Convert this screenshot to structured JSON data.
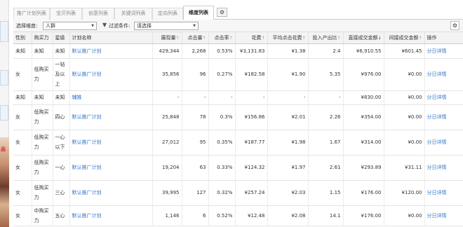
{
  "tabs": [
    {
      "label": "推广计划列表",
      "active": false
    },
    {
      "label": "宝贝列表",
      "active": false
    },
    {
      "label": "创意列表",
      "active": false
    },
    {
      "label": "关键词列表",
      "active": false
    },
    {
      "label": "定向列表",
      "active": false
    },
    {
      "label": "维度列表",
      "active": true
    }
  ],
  "tab_settings_icon": "gear-icon",
  "filter": {
    "dimension_label": "选择维度:",
    "dimension_value": "人群",
    "condition_label": "过滤条件:",
    "condition_value": "请选择",
    "settings_icon": "gear-icon"
  },
  "left_strip": {
    "banner_char": "品"
  },
  "columns": {
    "gender": "性别",
    "spending": "购买力",
    "star": "星级",
    "plan": "计划名称",
    "impressions": "展现量",
    "clicks": "点击量",
    "ctr": "点击率",
    "cost": "花费",
    "cpc": "平均点击花费",
    "roi": "投入产出比",
    "direct": "直接成交金额",
    "indirect": "间接成交金额",
    "action": "操作"
  },
  "rows": [
    {
      "gender": "未知",
      "spending": "未知",
      "star": "未知",
      "plan": "默认推广计划",
      "impressions": "429,344",
      "clicks": "2,268",
      "ctr": "0.53%",
      "cost": "¥3,131.83",
      "cpc": "¥1.38",
      "roi": "2.4",
      "direct": "¥6,910.55",
      "indirect": "¥601.45",
      "action": "分日详情"
    },
    {
      "gender": "女",
      "spending": "低购买力",
      "star": "一钻及以上",
      "plan": "默认推广计划",
      "impressions": "35,856",
      "clicks": "96",
      "ctr": "0.27%",
      "cost": "¥182.58",
      "cpc": "¥1.90",
      "roi": "5.35",
      "direct": "¥976.00",
      "indirect": "¥0.00",
      "action": "分日详情"
    },
    {
      "gender": "未知",
      "spending": "未知",
      "star": "未知",
      "plan": "辅推",
      "impressions": "-",
      "clicks": "-",
      "ctr": "-",
      "cost": "-",
      "cpc": "-",
      "roi": "-",
      "direct": "¥830.00",
      "indirect": "¥0.00",
      "action": "分日详情"
    },
    {
      "gender": "女",
      "spending": "低购买力",
      "star": "四心",
      "plan": "默认推广计划",
      "impressions": "25,848",
      "clicks": "78",
      "ctr": "0.3%",
      "cost": "¥156.86",
      "cpc": "¥2.01",
      "roi": "2.26",
      "direct": "¥354.00",
      "indirect": "¥0.00",
      "action": "分日详情"
    },
    {
      "gender": "女",
      "spending": "低购买力",
      "star": "一心以下",
      "plan": "默认推广计划",
      "impressions": "27,012",
      "clicks": "95",
      "ctr": "0.35%",
      "cost": "¥187.77",
      "cpc": "¥1.98",
      "roi": "1.67",
      "direct": "¥314.00",
      "indirect": "¥0.00",
      "action": "分日详情"
    },
    {
      "gender": "女",
      "spending": "低购买力",
      "star": "一心",
      "plan": "默认推广计划",
      "impressions": "19,204",
      "clicks": "63",
      "ctr": "0.33%",
      "cost": "¥124.32",
      "cpc": "¥1.97",
      "roi": "2.61",
      "direct": "¥293.89",
      "indirect": "¥31.11",
      "action": "分日详情"
    },
    {
      "gender": "女",
      "spending": "低购买力",
      "star": "三心",
      "plan": "默认推广计划",
      "impressions": "39,995",
      "clicks": "127",
      "ctr": "0.32%",
      "cost": "¥257.24",
      "cpc": "¥2.03",
      "roi": "1.15",
      "direct": "¥176.00",
      "indirect": "¥120.00",
      "action": "分日详情"
    },
    {
      "gender": "女",
      "spending": "中购买力",
      "star": "五心",
      "plan": "默认推广计划",
      "impressions": "1,146",
      "clicks": "6",
      "ctr": "0.52%",
      "cost": "¥12.48",
      "cpc": "¥2.08",
      "roi": "14.1",
      "direct": "¥176.00",
      "indirect": "¥0.00",
      "action": "分日详情"
    }
  ]
}
